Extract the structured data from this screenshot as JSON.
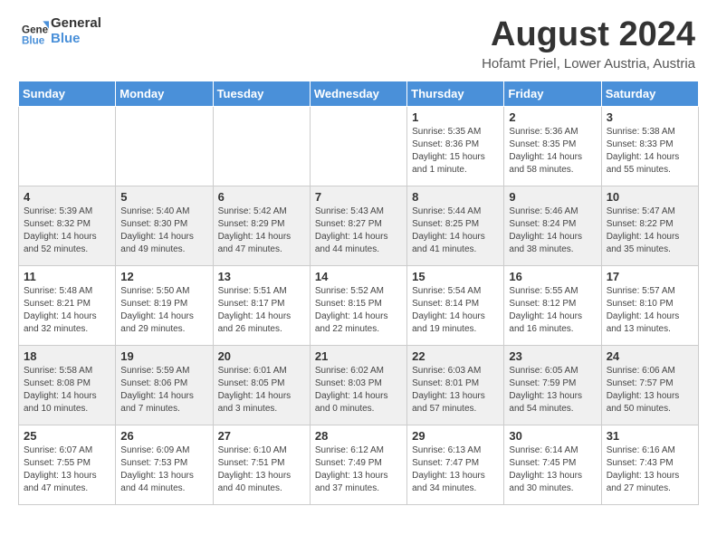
{
  "header": {
    "logo_line1": "General",
    "logo_line2": "Blue",
    "title": "August 2024",
    "subtitle": "Hofamt Priel, Lower Austria, Austria"
  },
  "days_of_week": [
    "Sunday",
    "Monday",
    "Tuesday",
    "Wednesday",
    "Thursday",
    "Friday",
    "Saturday"
  ],
  "weeks": [
    [
      {
        "day": "",
        "info": ""
      },
      {
        "day": "",
        "info": ""
      },
      {
        "day": "",
        "info": ""
      },
      {
        "day": "",
        "info": ""
      },
      {
        "day": "1",
        "info": "Sunrise: 5:35 AM\nSunset: 8:36 PM\nDaylight: 15 hours\nand 1 minute."
      },
      {
        "day": "2",
        "info": "Sunrise: 5:36 AM\nSunset: 8:35 PM\nDaylight: 14 hours\nand 58 minutes."
      },
      {
        "day": "3",
        "info": "Sunrise: 5:38 AM\nSunset: 8:33 PM\nDaylight: 14 hours\nand 55 minutes."
      }
    ],
    [
      {
        "day": "4",
        "info": "Sunrise: 5:39 AM\nSunset: 8:32 PM\nDaylight: 14 hours\nand 52 minutes."
      },
      {
        "day": "5",
        "info": "Sunrise: 5:40 AM\nSunset: 8:30 PM\nDaylight: 14 hours\nand 49 minutes."
      },
      {
        "day": "6",
        "info": "Sunrise: 5:42 AM\nSunset: 8:29 PM\nDaylight: 14 hours\nand 47 minutes."
      },
      {
        "day": "7",
        "info": "Sunrise: 5:43 AM\nSunset: 8:27 PM\nDaylight: 14 hours\nand 44 minutes."
      },
      {
        "day": "8",
        "info": "Sunrise: 5:44 AM\nSunset: 8:25 PM\nDaylight: 14 hours\nand 41 minutes."
      },
      {
        "day": "9",
        "info": "Sunrise: 5:46 AM\nSunset: 8:24 PM\nDaylight: 14 hours\nand 38 minutes."
      },
      {
        "day": "10",
        "info": "Sunrise: 5:47 AM\nSunset: 8:22 PM\nDaylight: 14 hours\nand 35 minutes."
      }
    ],
    [
      {
        "day": "11",
        "info": "Sunrise: 5:48 AM\nSunset: 8:21 PM\nDaylight: 14 hours\nand 32 minutes."
      },
      {
        "day": "12",
        "info": "Sunrise: 5:50 AM\nSunset: 8:19 PM\nDaylight: 14 hours\nand 29 minutes."
      },
      {
        "day": "13",
        "info": "Sunrise: 5:51 AM\nSunset: 8:17 PM\nDaylight: 14 hours\nand 26 minutes."
      },
      {
        "day": "14",
        "info": "Sunrise: 5:52 AM\nSunset: 8:15 PM\nDaylight: 14 hours\nand 22 minutes."
      },
      {
        "day": "15",
        "info": "Sunrise: 5:54 AM\nSunset: 8:14 PM\nDaylight: 14 hours\nand 19 minutes."
      },
      {
        "day": "16",
        "info": "Sunrise: 5:55 AM\nSunset: 8:12 PM\nDaylight: 14 hours\nand 16 minutes."
      },
      {
        "day": "17",
        "info": "Sunrise: 5:57 AM\nSunset: 8:10 PM\nDaylight: 14 hours\nand 13 minutes."
      }
    ],
    [
      {
        "day": "18",
        "info": "Sunrise: 5:58 AM\nSunset: 8:08 PM\nDaylight: 14 hours\nand 10 minutes."
      },
      {
        "day": "19",
        "info": "Sunrise: 5:59 AM\nSunset: 8:06 PM\nDaylight: 14 hours\nand 7 minutes."
      },
      {
        "day": "20",
        "info": "Sunrise: 6:01 AM\nSunset: 8:05 PM\nDaylight: 14 hours\nand 3 minutes."
      },
      {
        "day": "21",
        "info": "Sunrise: 6:02 AM\nSunset: 8:03 PM\nDaylight: 14 hours\nand 0 minutes."
      },
      {
        "day": "22",
        "info": "Sunrise: 6:03 AM\nSunset: 8:01 PM\nDaylight: 13 hours\nand 57 minutes."
      },
      {
        "day": "23",
        "info": "Sunrise: 6:05 AM\nSunset: 7:59 PM\nDaylight: 13 hours\nand 54 minutes."
      },
      {
        "day": "24",
        "info": "Sunrise: 6:06 AM\nSunset: 7:57 PM\nDaylight: 13 hours\nand 50 minutes."
      }
    ],
    [
      {
        "day": "25",
        "info": "Sunrise: 6:07 AM\nSunset: 7:55 PM\nDaylight: 13 hours\nand 47 minutes."
      },
      {
        "day": "26",
        "info": "Sunrise: 6:09 AM\nSunset: 7:53 PM\nDaylight: 13 hours\nand 44 minutes."
      },
      {
        "day": "27",
        "info": "Sunrise: 6:10 AM\nSunset: 7:51 PM\nDaylight: 13 hours\nand 40 minutes."
      },
      {
        "day": "28",
        "info": "Sunrise: 6:12 AM\nSunset: 7:49 PM\nDaylight: 13 hours\nand 37 minutes."
      },
      {
        "day": "29",
        "info": "Sunrise: 6:13 AM\nSunset: 7:47 PM\nDaylight: 13 hours\nand 34 minutes."
      },
      {
        "day": "30",
        "info": "Sunrise: 6:14 AM\nSunset: 7:45 PM\nDaylight: 13 hours\nand 30 minutes."
      },
      {
        "day": "31",
        "info": "Sunrise: 6:16 AM\nSunset: 7:43 PM\nDaylight: 13 hours\nand 27 minutes."
      }
    ]
  ]
}
